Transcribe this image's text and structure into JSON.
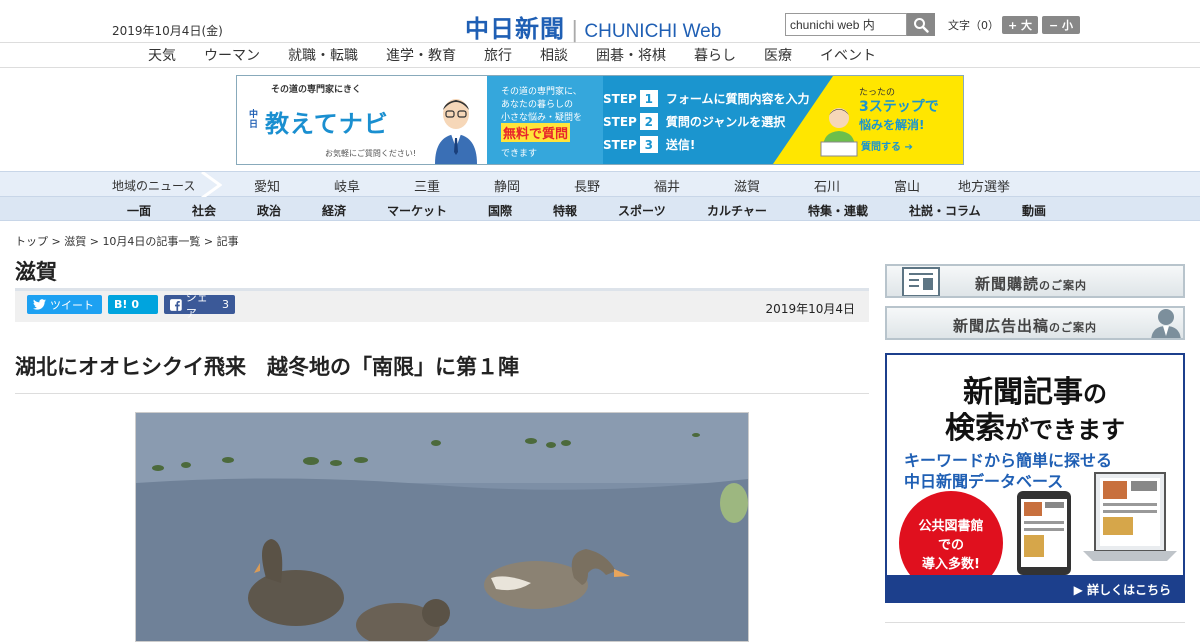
{
  "header": {
    "date": "2019年10月4日(金)",
    "logo_ja": "中日新聞",
    "logo_sep": "|",
    "logo_en_a": "CHUNICHI ",
    "logo_en_b": "Web",
    "search_value": "chunichi web 内",
    "font_label": "文字（0）",
    "font_larger": "+ 大",
    "font_smaller": "− 小",
    "brand_color": "#1f5fb4"
  },
  "top_nav": [
    "天気",
    "ウーマン",
    "就職・転職",
    "進学・教育",
    "旅行",
    "相談",
    "囲碁・将棋",
    "暮らし",
    "医療",
    "イベント"
  ],
  "banner": {
    "brand_small": "中日",
    "catch": "その道の専門家にきく",
    "title": "教えてナビ",
    "sub": "お気軽にご質問ください!",
    "mid_l1": "その道の専門家に、",
    "mid_l2": "あなたの暮らしの",
    "mid_l3": "小さな悩み・疑問を",
    "mid_hl": "無料で質問",
    "mid_l4": "できます",
    "step_label": "STEP",
    "steps": [
      {
        "num": "1",
        "text": "フォームに質問内容を入力"
      },
      {
        "num": "2",
        "text": "質問のジャンルを選択"
      },
      {
        "num": "3",
        "text": "送信!"
      }
    ],
    "right_l1": "たったの",
    "right_l2": "3ステップで",
    "right_l3": "悩みを解消!",
    "cta": "質問する"
  },
  "region_nav": {
    "label": "地域のニュース",
    "items": [
      "愛知",
      "岐阜",
      "三重",
      "静岡",
      "長野",
      "福井",
      "滋賀",
      "石川",
      "富山",
      "地方選挙"
    ]
  },
  "genre_nav": [
    "一面",
    "社会",
    "政治",
    "経済",
    "マーケット",
    "国際",
    "特報",
    "スポーツ",
    "カルチャー",
    "特集・連載",
    "社説・コラム",
    "動画"
  ],
  "breadcrumb": {
    "top": "トップ",
    "sep": " > ",
    "section": "滋賀",
    "list": "10月4日の記事一覧",
    "current": "記事"
  },
  "article": {
    "section_title": "滋賀",
    "tweet": "ツイート",
    "hatena_label": "B!",
    "hatena_count": "0",
    "fb_label": "シェア",
    "fb_count": "3",
    "date": "2019年10月4日",
    "headline": "湖北にオオヒシクイ飛来　越冬地の「南限」に第１陣"
  },
  "sidebar": {
    "subscribe_main": "新聞購読",
    "subscribe_sub": "のご案内",
    "advert_main": "新聞広告出稿",
    "advert_sub": "のご案内",
    "ad_l1a": "新聞記事",
    "ad_l1b": "の",
    "ad_l2a": "検索",
    "ad_l2b": "ができます",
    "ad_l3": "キーワードから簡単に探せる",
    "ad_l4": "中日新聞データベース",
    "ad_badge_1": "公共図書館",
    "ad_badge_2": "での",
    "ad_badge_3": "導入多数!",
    "ad_footer": "▶ 詳しくはこちら"
  }
}
